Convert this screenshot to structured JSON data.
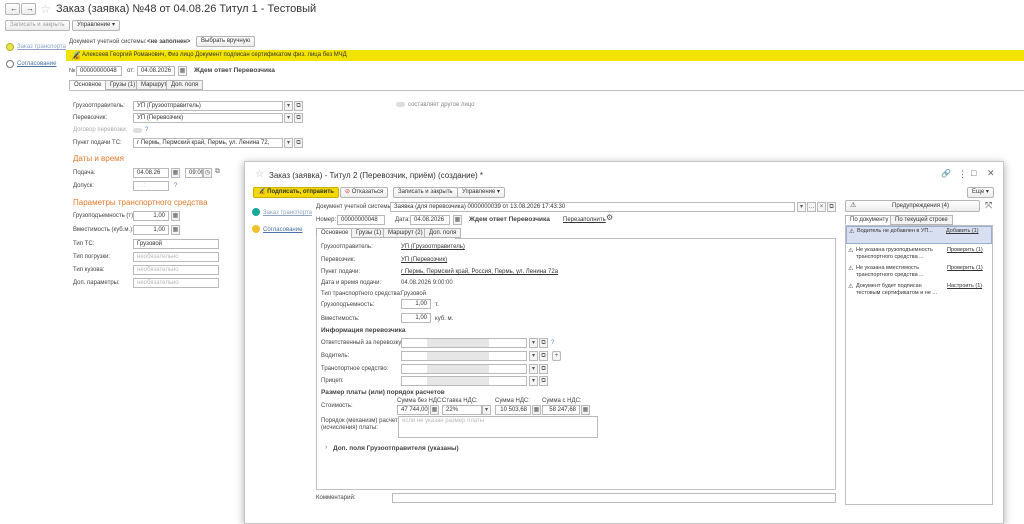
{
  "main": {
    "title": "Заказ (заявка) №48 от 04.08.26 Титул 1 - Тестовый",
    "toolbar": {
      "save_close": "Записать и закрыть",
      "manage": "Управление"
    },
    "nav": {
      "order": "Заказ транспорта",
      "approval": "Согласование"
    },
    "doc_label": "Документ учетной системы:",
    "doc_value": "<не заполнен>",
    "choose_manual": "Выбрать вручную",
    "banner": "Алексеев Георгий Романович, Физ лицо  Документ подписан сертификатом физ. лица без МЧД",
    "num_label": "№:",
    "num_value": "00000000048",
    "from_label": "от:",
    "date_value": "04.08.2026",
    "status": "Ждем ответ Перевозчика",
    "tabs": [
      "Основное",
      "Грузы (1)",
      "Маршрут",
      "Доп. поля"
    ],
    "shipper_label": "Грузоотправитель:",
    "shipper_value": "УП (Грузоотправитель)",
    "other_person": "составляет другое лицо",
    "carrier_label": "Перевозчик:",
    "carrier_value": "УП (Перевозчик)",
    "contract_label": "Договор перевозки:",
    "contract_q": "?",
    "point_label": "Пункт подачи ТС:",
    "point_value": "г Пермь, Пермский край, Пермь, ул. Ленина 72,",
    "dates_header": "Даты и время",
    "submit_label": "Подача:",
    "submit_date": "04.08.26",
    "submit_time": "09:00",
    "admit_label": "Допуск:",
    "admit_q": "?",
    "params_header": "Параметры транспортного средства",
    "capacity_label": "Грузоподъемность (т):",
    "capacity_value": "1,00",
    "volume_label": "Вместимость (куб.м.):",
    "volume_value": "1,00",
    "ts_type_label": "Тип ТС:",
    "ts_type_value": "Грузовой",
    "load_type_label": "Тип погрузки:",
    "body_type_label": "Тип кузова:",
    "extra_params_label": "Доп. параметры:",
    "required_ph": "необязательно"
  },
  "dialog": {
    "title": "Заказ (заявка) - Титул 2 (Перевозчик, приём) (создание) *",
    "sign_send": "Подписать, отправить",
    "refuse": "Отказаться",
    "save_close": "Записать и закрыть",
    "manage": "Управление",
    "more": "Еще",
    "nav": {
      "order": "Заказ транспорта",
      "approval": "Согласование"
    },
    "doc_label": "Документ учетной системы:",
    "doc_value": "Заявка (для перевозчика) 0000000039 от 13.08.2026 17:43:30",
    "num_label": "Номер:",
    "num_value": "00000000048",
    "date_label": "Дата:",
    "date_value": "04.08.2026",
    "status": "Ждем ответ Перевозчика",
    "refill": "Перезаполнить",
    "tabs": [
      "Основное",
      "Грузы (1)",
      "Маршрут (2)",
      "Доп. поля"
    ],
    "rows": [
      {
        "label": "Грузоотправитель:",
        "value": "УП (Грузоотправитель)",
        "link": true
      },
      {
        "label": "Перевозчик:",
        "value": "УП (Перевозчик)",
        "link": true
      },
      {
        "label": "Пункт подачи:",
        "value": "г Пермь, Пермский край, Россия, Пермь, ул. Ленина 72а",
        "link": true
      },
      {
        "label": "Дата и время подачи:",
        "value": "04.08.2026 9:00:00",
        "link": false
      },
      {
        "label": "Тип транспортного средства:",
        "value": "Грузовой",
        "link": false
      }
    ],
    "capacity_label": "Грузоподъемность:",
    "capacity_value": "1,00",
    "capacity_unit": "т.",
    "volume_label": "Вместимость:",
    "volume_value": "1,00",
    "volume_unit": "куб. м.",
    "carrier_info_header": "Информация перевозчика",
    "responsible_label": "Ответственный за перевозку:",
    "responsible_q": "?",
    "driver_label": "Водитель:",
    "vehicle_label": "Транспортное средство:",
    "trailer_label": "Прицеп:",
    "payment_header": "Размер платы (или) порядок расчетов",
    "cost_label": "Стоимость:",
    "sum_no_vat_label": "Сумма без НДС:",
    "vat_rate_label": "Ставка НДС:",
    "vat_sum_label": "Сумма НДС:",
    "sum_with_vat_label": "Сумма с НДС:",
    "sum_no_vat": "47 744,00",
    "vat_rate": "22%",
    "vat_sum": "10 503,68",
    "sum_with_vat": "58 247,68",
    "order_label": "Порядок (механизм) расчета (исчисления) платы:",
    "order_ph": "если не указан размер платы",
    "extra_fields": "Доп. поля Грузоотправителя (указаны)",
    "comment_label": "Комментарий:",
    "warnings_btn": "Предупреждения (4)",
    "by_doc_tab": "По документу",
    "by_row_tab": "По текущей строке",
    "warnings": [
      {
        "text": "Водитель не добавлен в УП...",
        "action": "Добавить (1)"
      },
      {
        "text": "Не указана грузоподъемность транспортного средства ...",
        "action": "Проверить (1)"
      },
      {
        "text": "Не указана вместимость транспортного средства ...",
        "action": "Проверить (1)"
      },
      {
        "text": "Документ будет подписан тестовым сертификатом и не ...",
        "action": "Настроить (1)"
      }
    ]
  }
}
